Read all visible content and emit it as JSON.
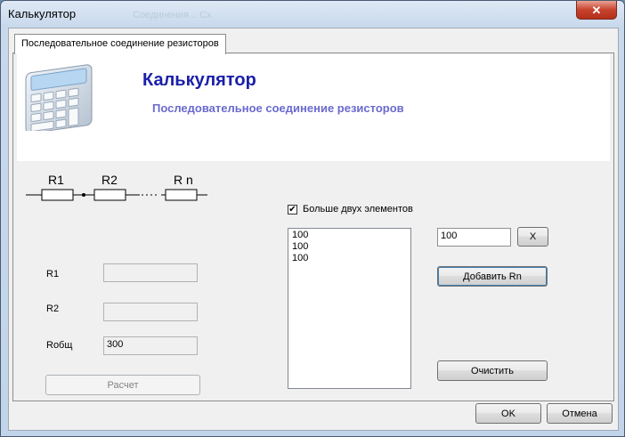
{
  "window": {
    "title": "Калькулятор",
    "ghost_title": "Соединения... Сх",
    "close_label": "✕"
  },
  "tab": {
    "label": "Последовательное соединение резисторов"
  },
  "header": {
    "title": "Калькулятор",
    "subtitle": "Последовательное соединение резисторов"
  },
  "diagram": {
    "r1": "R1",
    "r2": "R2",
    "rn": "R n"
  },
  "form": {
    "r1_label": "R1",
    "r1_value": "",
    "r2_label": "R2",
    "r2_value": "",
    "rtotal_label": "Rобщ",
    "rtotal_value": "300",
    "calc_button": "Расчет"
  },
  "multi": {
    "checkbox_label": "Больше двух элементов",
    "checked": true,
    "list_items": [
      "100",
      "100",
      "100"
    ],
    "input_value": "100",
    "x_button": "X",
    "add_button": "Добавить Rn",
    "clear_button": "Очистить"
  },
  "footer": {
    "ok": "OK",
    "cancel": "Отмена"
  }
}
